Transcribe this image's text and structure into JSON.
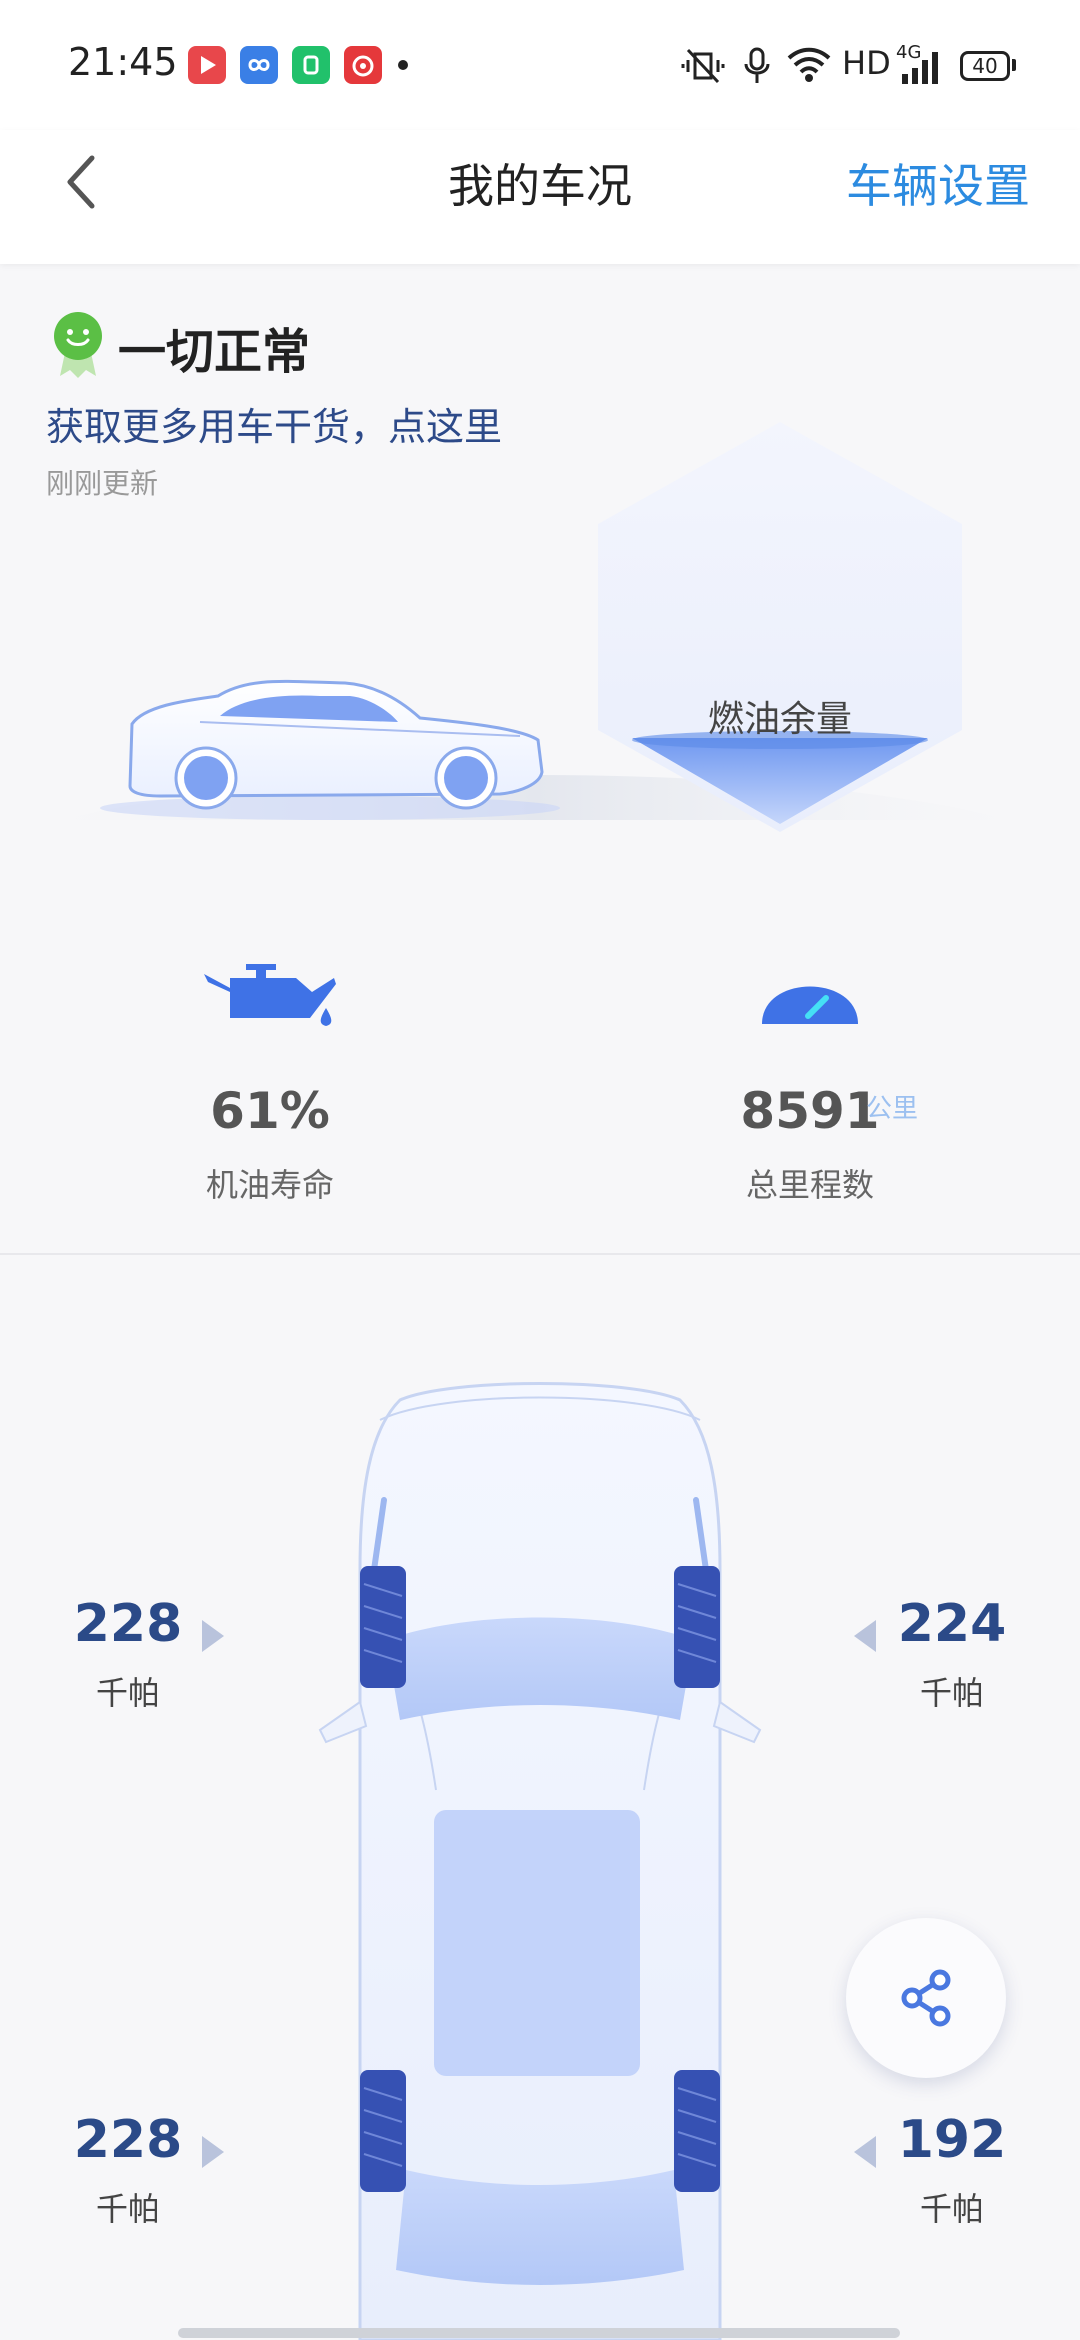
{
  "statusbar": {
    "time": "21:45",
    "hd": "HD",
    "network": "4G",
    "battery": "40",
    "app_icons": [
      {
        "icon": "video-app-icon",
        "color": "#e8474b"
      },
      {
        "icon": "infinity-app-icon",
        "color": "#3a7fe6"
      },
      {
        "icon": "green-app-icon",
        "color": "#21c16b"
      },
      {
        "icon": "music-app-icon",
        "color": "#e5383b"
      }
    ]
  },
  "nav": {
    "title": "我的车况",
    "action": "车辆设置"
  },
  "status": {
    "title": "一切正常",
    "link": "获取更多用车干货，点这里",
    "updated": "刚刚更新",
    "fuel_label": "燃油余量"
  },
  "stats": {
    "oil": {
      "value": "61%",
      "label": "机油寿命"
    },
    "mileage": {
      "value": "8591",
      "unit": "公里",
      "label": "总里程数"
    }
  },
  "tires": {
    "front_left": {
      "value": "228",
      "unit": "千帕"
    },
    "front_right": {
      "value": "224",
      "unit": "千帕"
    },
    "rear_left": {
      "value": "228",
      "unit": "千帕"
    },
    "rear_right": {
      "value": "192",
      "unit": "千帕"
    }
  },
  "colors": {
    "accent": "#2c8be0",
    "tire_text": "#2b4a88",
    "link": "#2d4a89"
  }
}
